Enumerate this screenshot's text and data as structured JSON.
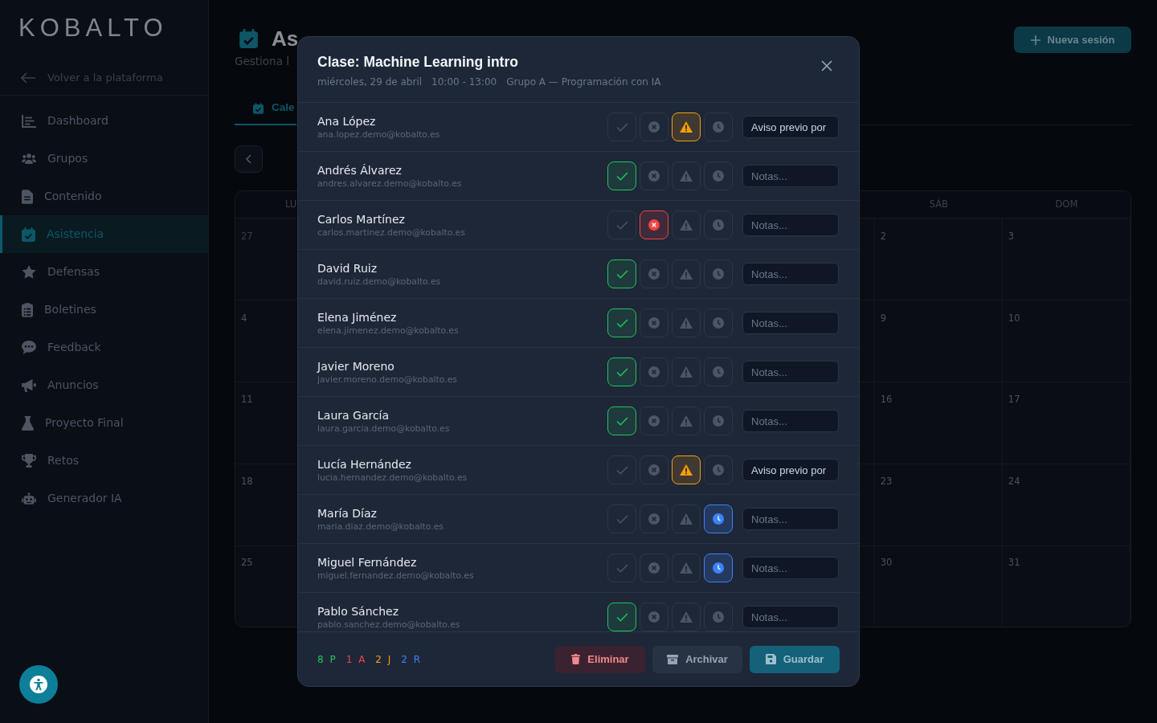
{
  "sidebar": {
    "logo": "KOBALTO",
    "back_link": "Volver a la plataforma",
    "items": [
      {
        "label": "Dashboard",
        "selected": false
      },
      {
        "label": "Grupos",
        "selected": false
      },
      {
        "label": "Contenido",
        "selected": false
      },
      {
        "label": "Asistencia",
        "selected": true
      },
      {
        "label": "Defensas",
        "selected": false
      },
      {
        "label": "Boletines",
        "selected": false
      },
      {
        "label": "Feedback",
        "selected": false
      },
      {
        "label": "Anuncios",
        "selected": false
      },
      {
        "label": "Proyecto Final",
        "selected": false
      },
      {
        "label": "Retos",
        "selected": false
      },
      {
        "label": "Generador IA",
        "selected": false
      }
    ]
  },
  "header": {
    "title": "As",
    "subtitle": "Gestiona l",
    "new_button": "Nueva sesión"
  },
  "tabs": [
    {
      "label": "Cale",
      "selected": true
    }
  ],
  "calendar": {
    "columns": [
      {
        "header": "LU",
        "days": [
          {
            "label": "27",
            "outside": true
          },
          {
            "label": "4",
            "outside": false
          },
          {
            "label": "11",
            "outside": false
          },
          {
            "label": "18",
            "outside": false
          },
          {
            "label": "25",
            "outside": false
          }
        ]
      },
      {
        "header": "SÁB",
        "days": [
          {
            "label": "2",
            "outside": false
          },
          {
            "label": "9",
            "outside": false
          },
          {
            "label": "16",
            "outside": false
          },
          {
            "label": "23",
            "outside": false
          },
          {
            "label": "30",
            "outside": false
          }
        ]
      },
      {
        "header": "DOM",
        "days": [
          {
            "label": "3",
            "outside": false
          },
          {
            "label": "10",
            "outside": false
          },
          {
            "label": "17",
            "outside": false
          },
          {
            "label": "24",
            "outside": false
          },
          {
            "label": "31",
            "outside": false
          }
        ]
      }
    ]
  },
  "modal": {
    "title": "Clase: Machine Learning intro",
    "meta": [
      "miércoles, 29 de abril",
      "10:00 - 13:00",
      "Grupo A — Programación con IA"
    ],
    "students": [
      {
        "name": "Ana López",
        "email": "ana.lopez.demo@kobalto.es",
        "present": false,
        "absent": false,
        "justified": true,
        "late": false,
        "note": "Aviso previo por"
      },
      {
        "name": "Andrés Álvarez",
        "email": "andres.alvarez.demo@kobalto.es",
        "present": true,
        "absent": false,
        "justified": false,
        "late": false,
        "placeholder": "Notas..."
      },
      {
        "name": "Carlos Martínez",
        "email": "carlos.martinez.demo@kobalto.es",
        "present": false,
        "absent": true,
        "justified": false,
        "late": false,
        "placeholder": "Notas..."
      },
      {
        "name": "David Ruiz",
        "email": "david.ruiz.demo@kobalto.es",
        "present": true,
        "absent": false,
        "justified": false,
        "late": false,
        "placeholder": "Notas..."
      },
      {
        "name": "Elena Jiménez",
        "email": "elena.jimenez.demo@kobalto.es",
        "present": true,
        "absent": false,
        "justified": false,
        "late": false,
        "placeholder": "Notas..."
      },
      {
        "name": "Javier Moreno",
        "email": "javier.moreno.demo@kobalto.es",
        "present": true,
        "absent": false,
        "justified": false,
        "late": false,
        "placeholder": "Notas..."
      },
      {
        "name": "Laura García",
        "email": "laura.garcia.demo@kobalto.es",
        "present": true,
        "absent": false,
        "justified": false,
        "late": false,
        "placeholder": "Notas..."
      },
      {
        "name": "Lucía Hernández",
        "email": "lucia.hernandez.demo@kobalto.es",
        "present": false,
        "absent": false,
        "justified": true,
        "late": false,
        "note": "Aviso previo por"
      },
      {
        "name": "María Díaz",
        "email": "maria.diaz.demo@kobalto.es",
        "present": false,
        "absent": false,
        "justified": false,
        "late": true,
        "placeholder": "Notas..."
      },
      {
        "name": "Miguel Fernández",
        "email": "miguel.fernandez.demo@kobalto.es",
        "present": false,
        "absent": false,
        "justified": false,
        "late": true,
        "placeholder": "Notas..."
      },
      {
        "name": "Pablo Sánchez",
        "email": "pablo.sanchez.demo@kobalto.es",
        "present": true,
        "absent": false,
        "justified": false,
        "late": false,
        "placeholder": "Notas..."
      }
    ],
    "summary": [
      {
        "text": "8 P",
        "color": "#22c55e"
      },
      {
        "text": "1 A",
        "color": "#ef4444"
      },
      {
        "text": "2 J",
        "color": "#f59e0b"
      },
      {
        "text": "2 R",
        "color": "#3b82f6"
      }
    ],
    "buttons": [
      {
        "label": "Eliminar",
        "kind": "danger"
      },
      {
        "label": "Archivar",
        "kind": "secondary"
      },
      {
        "label": "Guardar",
        "kind": "primary"
      }
    ]
  }
}
